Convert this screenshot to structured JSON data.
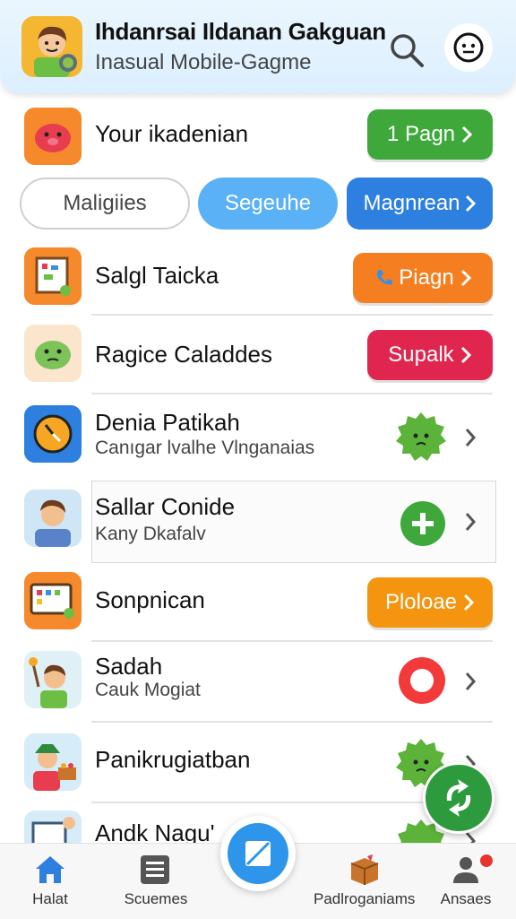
{
  "header": {
    "title": "Ihdanrsai Ildanan Gakguan",
    "subtitle": "Inasual Mobile-Gagme",
    "icons": {
      "avatar": "boy-avatar-icon",
      "search": "search-icon",
      "profile": "smiley-face-icon"
    }
  },
  "first_row": {
    "label": "Your ikadenian",
    "button": "1 Pagn"
  },
  "chips": [
    "Maligiies",
    "Segeuhe",
    "Magnrean"
  ],
  "items": [
    {
      "name": "Salgl Taicka",
      "sub": "",
      "action": "Piagn",
      "action_type": "pill",
      "color": "#f57f20"
    },
    {
      "name": "Ragice Caladdes",
      "sub": "",
      "action": "Supalk",
      "action_type": "pill",
      "color": "#e0264f"
    },
    {
      "name": "Denia Patikah",
      "sub": "Canıgar lvalhe Vlnganaias",
      "action": "",
      "action_type": "badge-green"
    },
    {
      "name": "Sallar Conide",
      "sub": "Kany Dkafalv",
      "action": "",
      "action_type": "plus"
    },
    {
      "name": "Sonpnican",
      "sub": "",
      "action": "Ploloae",
      "action_type": "pill",
      "color": "#f5940f"
    },
    {
      "name": "Sadah",
      "sub": "Cauk Mogiat",
      "action": "",
      "action_type": "red-circle"
    },
    {
      "name": "Panikrugiatban",
      "sub": "",
      "action": "",
      "action_type": "badge-green"
    },
    {
      "name": "Andk Nagu'",
      "sub": "",
      "action": "",
      "action_type": "badge-green"
    }
  ],
  "colors": {
    "green": "#3ea93a",
    "blue": "#2d7fe0",
    "lightblue": "#5ab1f5",
    "orange": "#f57f20",
    "red": "#e0264f",
    "fab_green": "#2e9a3e"
  },
  "bottom_nav": [
    "Halat",
    "Scuemes",
    "Padlroganiams",
    "Ansaes"
  ]
}
